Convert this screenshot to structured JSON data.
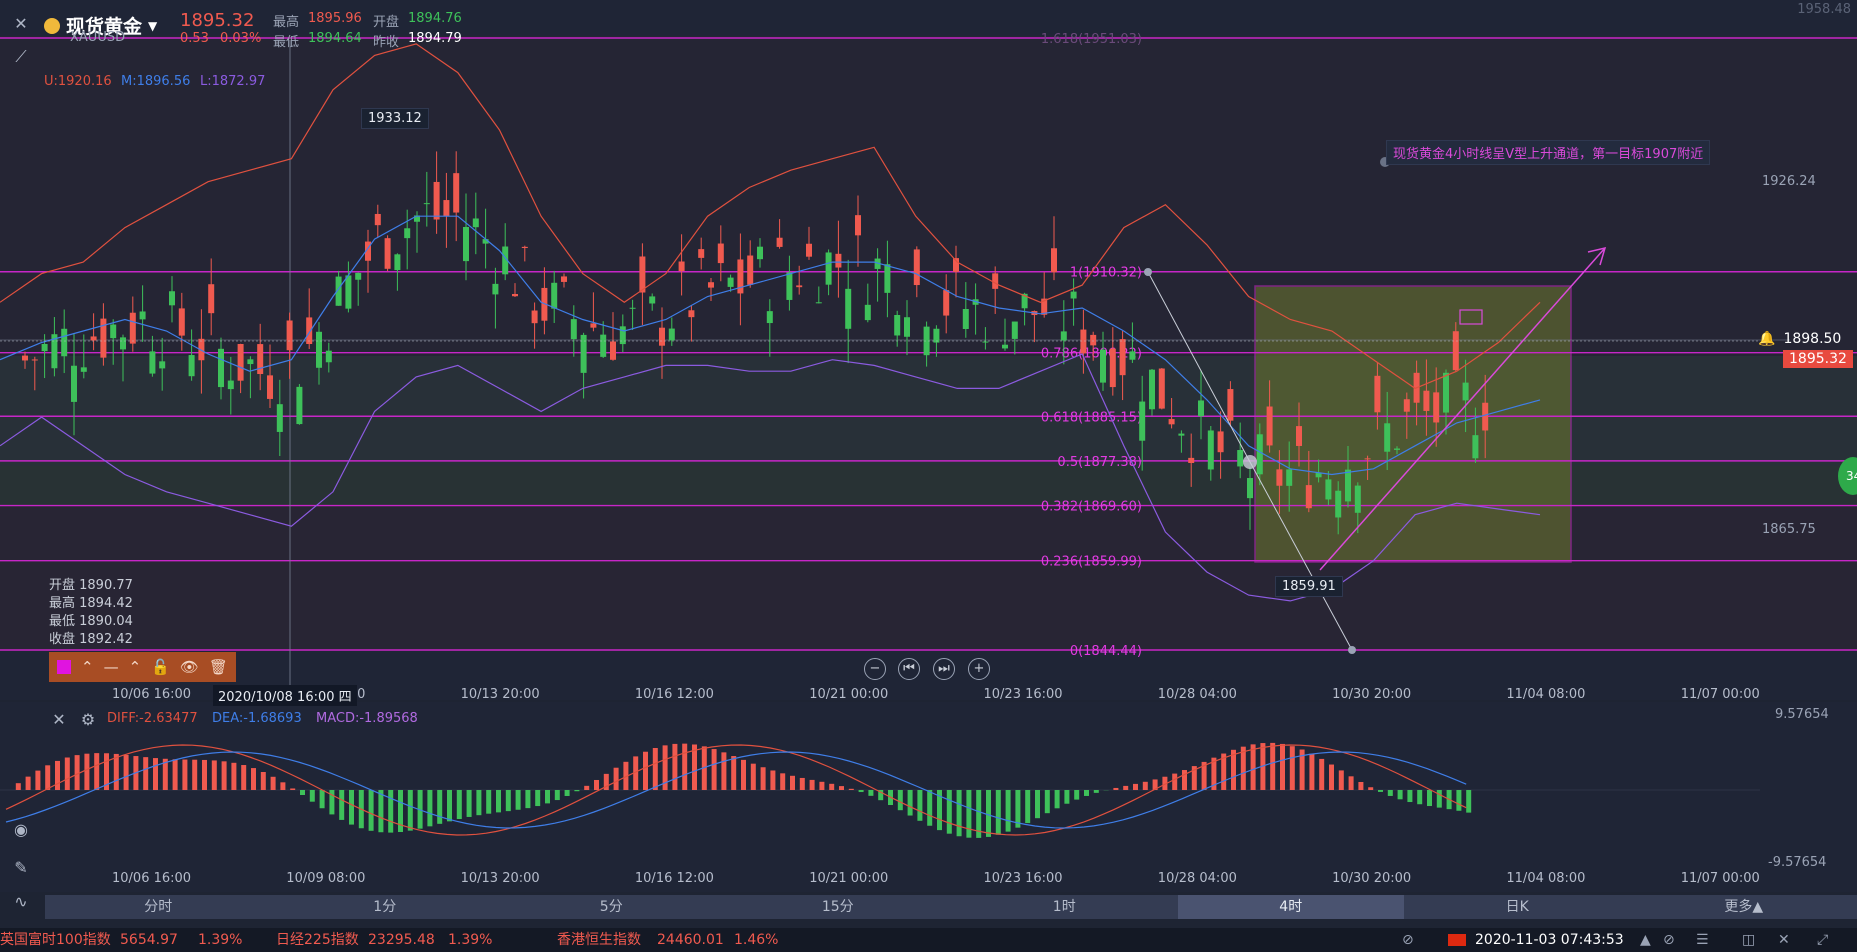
{
  "header": {
    "title": "现货黄金",
    "symbol": "XAUUSD",
    "price": "1895.32",
    "change": "0.53",
    "change_pct": "0.03%",
    "high_label": "最高",
    "high": "1895.96",
    "open_label": "开盘",
    "open": "1894.76",
    "low_label": "最低",
    "low": "1894.64",
    "prev_label": "昨收",
    "prev": "1894.79"
  },
  "boll": {
    "u": "U:1920.16",
    "m": "M:1896.56",
    "l": "L:1872.97"
  },
  "ohlc_panel": {
    "open": "开盘 1890.77",
    "high": "最高 1894.42",
    "low": "最低 1890.04",
    "close": "收盘 1892.42"
  },
  "tags": {
    "peak": "1933.12",
    "trough": "1859.91",
    "hover_date": "2020/10/08 16:00 四",
    "annotation": "现货黄金4小时线呈V型上升通道，第一目标1907附近",
    "price_line": "1898.50",
    "current_price": "1895.32",
    "side_badge": "34"
  },
  "fib": [
    {
      "label": "1.618(1951.03)",
      "value": 1951.03
    },
    {
      "label": "1(1910.32)",
      "value": 1910.32
    },
    {
      "label": "0.786(1896.22)",
      "value": 1896.22
    },
    {
      "label": "0.618(1885.15)",
      "value": 1885.15
    },
    {
      "label": "0.5(1877.38)",
      "value": 1877.38
    },
    {
      "label": "0.382(1869.60)",
      "value": 1869.6
    },
    {
      "label": "0.236(1859.99)",
      "value": 1859.99
    },
    {
      "label": "0(1844.44)",
      "value": 1844.44
    }
  ],
  "price_axis": [
    "1926.24",
    "1865.75"
  ],
  "macd_axis": [
    "9.57654",
    "-9.57654"
  ],
  "x_labels": [
    "10/06 16:00",
    "10/09 08:00",
    "10/13 20:00",
    "10/16 12:00",
    "10/21 00:00",
    "10/23 16:00",
    "10/28 04:00",
    "10/30 20:00",
    "11/04 08:00",
    "11/07 00:00"
  ],
  "macd_legend": {
    "diff": "DIFF:-2.63477",
    "dea": "DEA:-1.68693",
    "macd": "MACD:-1.89568"
  },
  "timeframes": [
    "分时",
    "1分",
    "5分",
    "15分",
    "1时",
    "4时",
    "日K",
    "更多▲"
  ],
  "active_timeframe": "4时",
  "status": {
    "item1_name": "英国富时100指数",
    "item1_value": "5654.97",
    "item1_pct": "1.39%",
    "item2_name": "日经225指数",
    "item2_value": "23295.48",
    "item2_pct": "1.39%",
    "item3_name": "香港恒生指数",
    "item3_value": "24460.01",
    "item3_pct": "1.46%",
    "datetime": "2020-11-03 07:43:53"
  },
  "colors": {
    "up": "#f05a4f",
    "down": "#3ec15a",
    "fib": "#c726c7",
    "mid": "#3f7ee8",
    "lower": "#8b5be0",
    "upper": "#e0513f"
  },
  "chart_data": {
    "type": "line",
    "title": "",
    "ylim": [
      1844.44,
      1955
    ],
    "series": [
      {
        "name": "U:1920.16",
        "values": [
          1905,
          1910,
          1912,
          1918,
          1922,
          1926,
          1928,
          1930,
          1942,
          1948,
          1950,
          1945,
          1935,
          1920,
          1910,
          1905,
          1910,
          1920,
          1925,
          1928,
          1930,
          1932,
          1920,
          1912,
          1908,
          1905,
          1908,
          1918,
          1922,
          1915,
          1906,
          1902,
          1900,
          1895,
          1890,
          1893,
          1898,
          1905
        ]
      },
      {
        "name": "M:1896.56",
        "values": [
          1895,
          1898,
          1900,
          1902,
          1900,
          1896,
          1893,
          1895,
          1906,
          1916,
          1920,
          1920,
          1914,
          1905,
          1902,
          1900,
          1902,
          1906,
          1908,
          1910,
          1912,
          1912,
          1910,
          1906,
          1904,
          1903,
          1904,
          1900,
          1895,
          1888,
          1880,
          1876,
          1875,
          1876,
          1880,
          1884,
          1886,
          1888
        ]
      },
      {
        "name": "L:1872.97",
        "values": [
          1880,
          1885,
          1880,
          1875,
          1872,
          1870,
          1868,
          1866,
          1872,
          1886,
          1892,
          1894,
          1890,
          1886,
          1890,
          1892,
          1894,
          1894,
          1893,
          1893,
          1895,
          1894,
          1892,
          1890,
          1890,
          1893,
          1896,
          1880,
          1865,
          1858,
          1854,
          1853,
          1855,
          1860,
          1868,
          1870,
          1869,
          1868
        ]
      }
    ]
  }
}
